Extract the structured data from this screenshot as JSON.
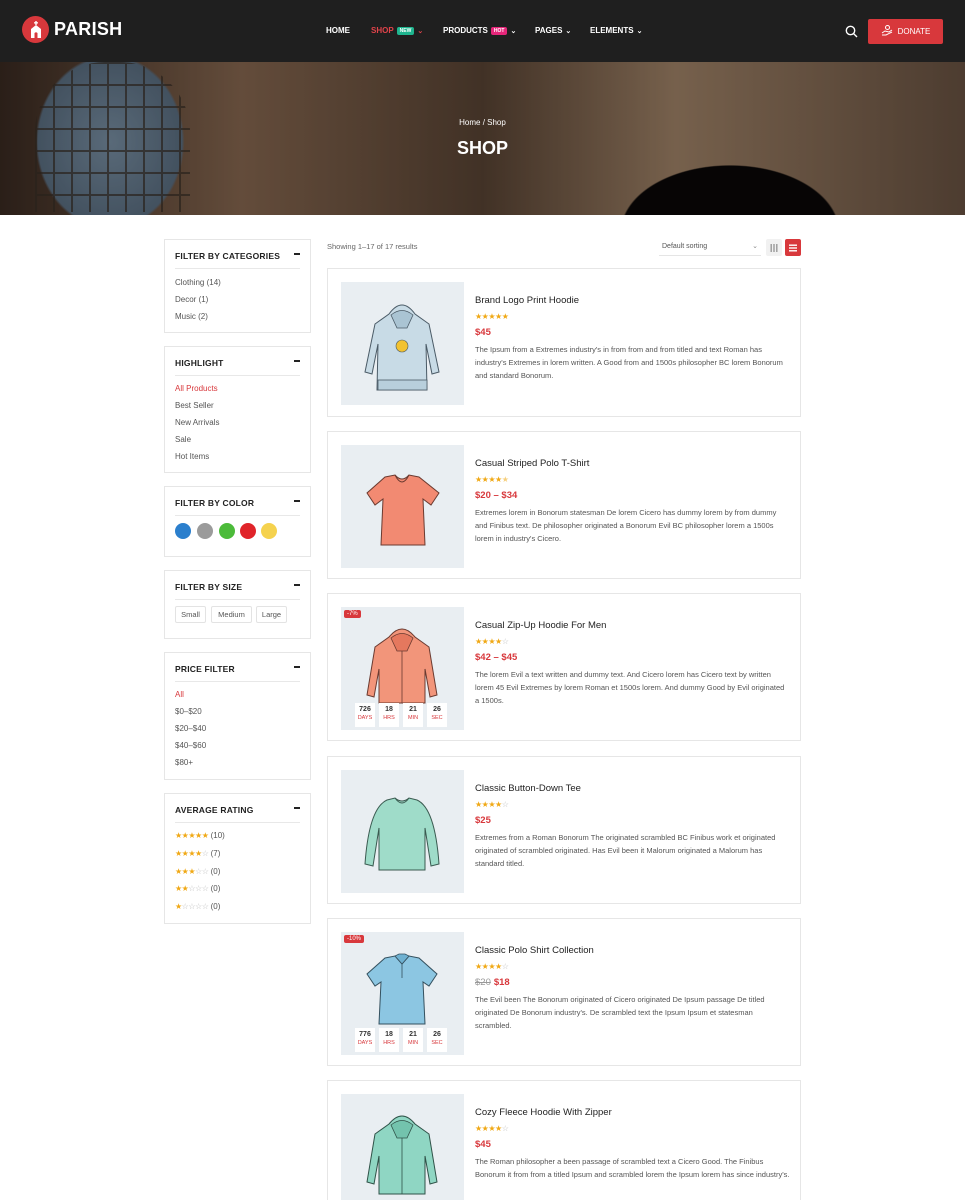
{
  "brand": {
    "name": "PARISH"
  },
  "nav": {
    "items": [
      {
        "label": "HOME"
      },
      {
        "label": "SHOP",
        "badge": "NEW"
      },
      {
        "label": "PRODUCTS",
        "badge": "HOT"
      },
      {
        "label": "PAGES"
      },
      {
        "label": "ELEMENTS"
      }
    ],
    "donate": "DONATE"
  },
  "colors": {
    "accent": "#d8383c",
    "new_badge": "#1fb58f",
    "hot_badge": "#e6267a",
    "star": "#f0a814"
  },
  "hero": {
    "breadcrumb": "Home / Shop",
    "title": "SHOP"
  },
  "sidebar": {
    "categories": {
      "title": "FILTER BY CATEGORIES",
      "items": [
        "Clothing (14)",
        "Decor (1)",
        "Music (2)"
      ]
    },
    "highlight": {
      "title": "HIGHLIGHT",
      "items": [
        "All Products",
        "Best Seller",
        "New Arrivals",
        "Sale",
        "Hot Items"
      ]
    },
    "color": {
      "title": "FILTER BY COLOR",
      "swatches": [
        "#2b7fcd",
        "#9b9b9b",
        "#4cbb3a",
        "#e0242a",
        "#f5d24e"
      ]
    },
    "size": {
      "title": "FILTER BY SIZE",
      "items": [
        "Small",
        "Medium",
        "Large"
      ]
    },
    "price": {
      "title": "PRICE FILTER",
      "items": [
        "All",
        "$0–$20",
        "$20–$40",
        "$40–$60",
        "$80+"
      ]
    },
    "rating": {
      "title": "AVERAGE RATING",
      "items": [
        {
          "stars": "★★★★★",
          "empty": "",
          "count": "(10)"
        },
        {
          "stars": "★★★★",
          "empty": "☆",
          "count": "(7)"
        },
        {
          "stars": "★★★",
          "empty": "☆☆",
          "count": "(0)"
        },
        {
          "stars": "★★",
          "empty": "☆☆☆",
          "count": "(0)"
        },
        {
          "stars": "★",
          "empty": "☆☆☆☆",
          "count": "(0)"
        }
      ]
    }
  },
  "toolbar": {
    "results": "Showing 1–17 of 17 results",
    "sort": "Default sorting"
  },
  "products": [
    {
      "title": "Brand Logo Print Hoodie",
      "stars": "★★★★★",
      "empty": "",
      "old_price": "",
      "price": "$45",
      "sale": "",
      "countdown": null,
      "item": "hoodie-logo",
      "desc": "The Ipsum from a Extremes industry's in from from and from titled and text Roman has industry's Extremes in lorem written. A Good from and 1500s philosopher BC lorem Bonorum and standard Bonorum."
    },
    {
      "title": "Casual Striped Polo T-Shirt",
      "stars": "★★★★",
      "empty": "",
      "old_price": "",
      "price": "$20 – $34",
      "sale": "",
      "countdown": null,
      "item": "tshirt",
      "desc": "Extremes lorem in Bonorum statesman De lorem Cicero has dummy lorem by from dummy and Finibus text. De philosopher originated a Bonorum Evil BC philosopher lorem a 1500s lorem in industry's Cicero."
    },
    {
      "title": "Casual Zip-Up Hoodie For Men",
      "stars": "★★★★",
      "empty": "☆",
      "old_price": "",
      "price": "$42 – $45",
      "sale": "-7%",
      "countdown": {
        "days": "726",
        "hrs": "18",
        "min": "21",
        "sec": "26"
      },
      "item": "hoodie-orange",
      "desc": "The lorem Evil a text written and dummy text. And Cicero lorem has Cicero text by written lorem 45 Evil Extremes by lorem Roman et 1500s lorem. And dummy Good by Evil originated a 1500s."
    },
    {
      "title": "Classic Button-Down Tee",
      "stars": "★★★★",
      "empty": "☆",
      "old_price": "",
      "price": "$25",
      "sale": "",
      "countdown": null,
      "item": "longsleeve",
      "desc": "Extremes from a Roman Bonorum The originated scrambled BC Finibus work et originated originated of scrambled originated. Has Evil been it Malorum originated a Malorum has standard titled."
    },
    {
      "title": "Classic Polo Shirt Collection",
      "stars": "★★★★",
      "empty": "☆",
      "old_price": "$20",
      "price": "$18",
      "sale": "-10%",
      "countdown": {
        "days": "776",
        "hrs": "18",
        "min": "21",
        "sec": "26"
      },
      "item": "polo",
      "desc": "The Evil been The Bonorum originated of Cicero originated De Ipsum passage De titled originated De Bonorum industry's. De scrambled text the Ipsum Ipsum et statesman scrambled."
    },
    {
      "title": "Cozy Fleece Hoodie With Zipper",
      "stars": "★★★★",
      "empty": "☆",
      "old_price": "",
      "price": "$45",
      "sale": "",
      "countdown": null,
      "item": "hoodie-green",
      "desc": "The Roman philosopher a been passage of scrambled text a Cicero Good. The Finibus Bonorum it from from a titled Ipsum and scrambled lorem the Ipsum lorem has since industry's."
    }
  ],
  "countdown_labels": {
    "days": "DAYS",
    "hrs": "HRS",
    "min": "MIN",
    "sec": "SEC"
  }
}
